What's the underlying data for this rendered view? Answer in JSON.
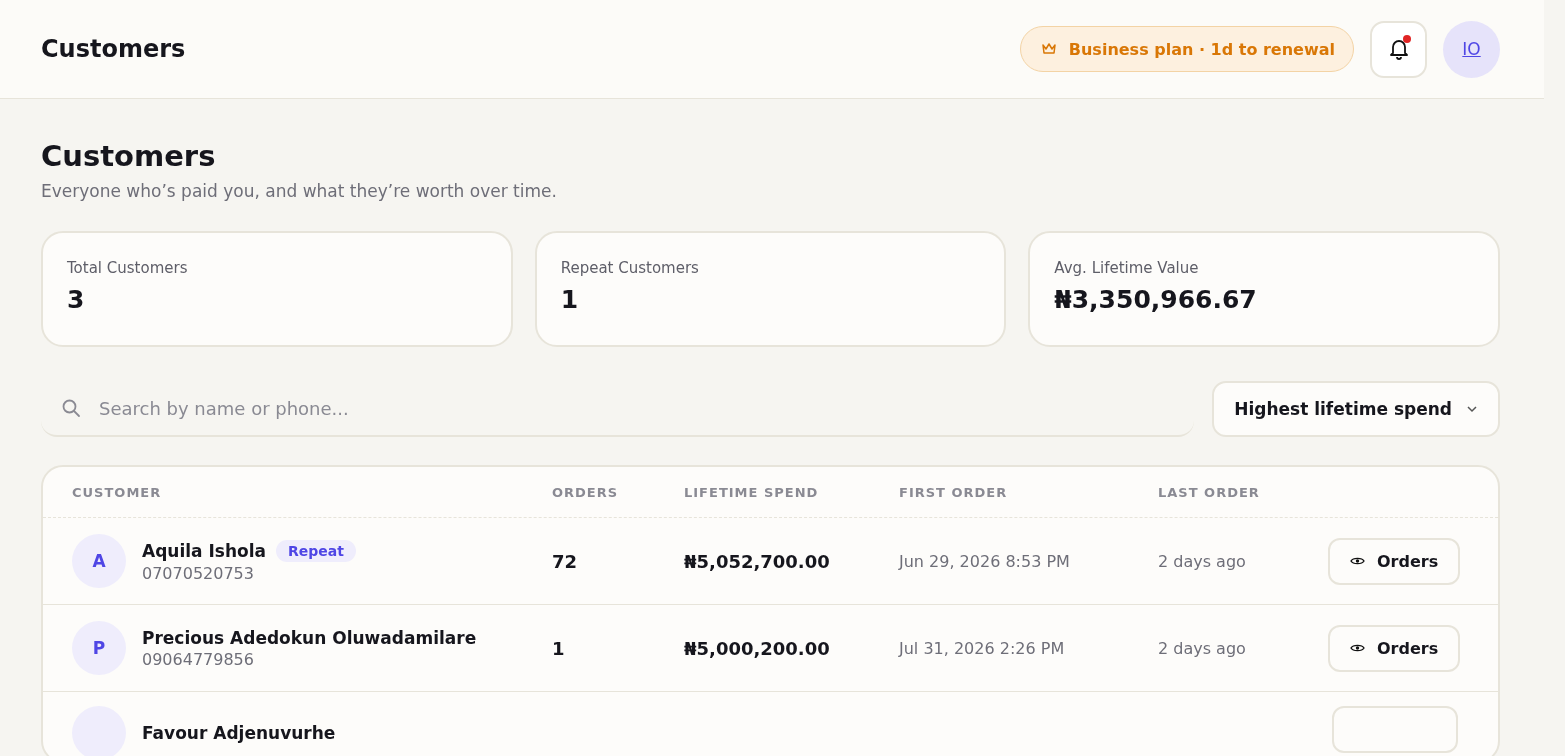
{
  "header": {
    "title": "Customers",
    "plan_badge": "Business plan · 1d to renewal",
    "notification_dot": true,
    "avatar_initials": "IO"
  },
  "page": {
    "title": "Customers",
    "subtitle": "Everyone who’s paid you, and what they’re worth over time."
  },
  "stats": [
    {
      "label": "Total Customers",
      "value": "3"
    },
    {
      "label": "Repeat Customers",
      "value": "1"
    },
    {
      "label": "Avg. Lifetime Value",
      "value": "₦3,350,966.67"
    }
  ],
  "search": {
    "placeholder": "Search by name or phone..."
  },
  "sort": {
    "value": "Highest lifetime spend"
  },
  "table": {
    "columns": [
      "CUSTOMER",
      "ORDERS",
      "LIFETIME SPEND",
      "FIRST ORDER",
      "LAST ORDER"
    ],
    "rows": [
      {
        "kind": "full",
        "initial": "A",
        "name": "Aquila Ishola",
        "badge": "Repeat",
        "phone": "07070520753",
        "orders": "72",
        "spend": "₦5,052,700.00",
        "first_order": "Jun 29, 2026 8:53 PM",
        "last_order": "2 days ago",
        "action": "Orders"
      },
      {
        "kind": "full",
        "initial": "P",
        "name": "Precious Adedokun Oluwadamilare",
        "phone": "09064779856",
        "orders": "1",
        "spend": "₦5,000,200.00",
        "first_order": "Jul 31, 2026 2:26 PM",
        "last_order": "2 days ago",
        "action": "Orders"
      },
      {
        "kind": "partial",
        "name": "Favour Adjenuvurhe"
      }
    ]
  }
}
